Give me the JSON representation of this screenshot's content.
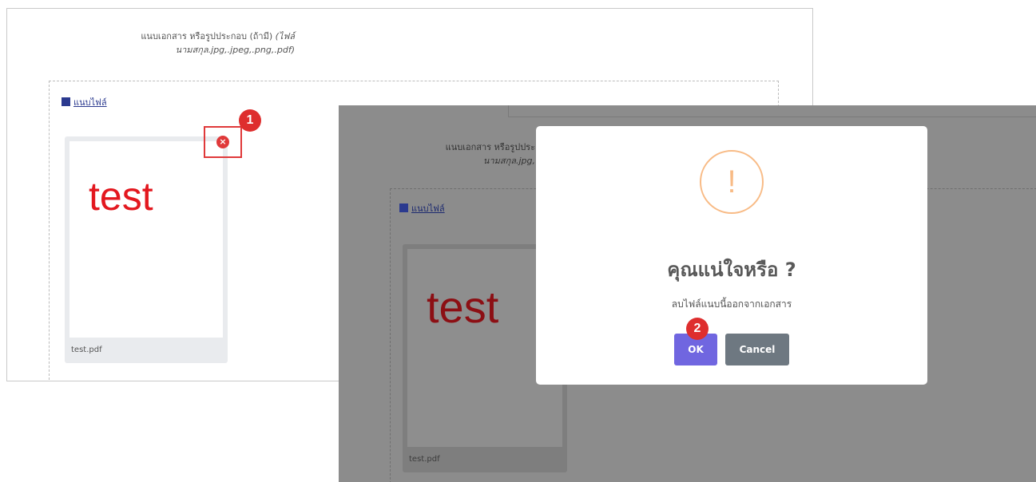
{
  "before": {
    "field_label": "แนบเอกสาร หรือรูปประกอบ (ถ้ามี)",
    "field_hint": "(ไฟล์นามสกุล.jpg,.jpeg,.png,.pdf)",
    "attach_link": "แนบไฟล์",
    "file_preview_text": "test",
    "file_name": "test.pdf",
    "remove_symbol": "×",
    "step_marker": "1"
  },
  "after": {
    "field_label": "แนบเอกสาร หรือรูปประ",
    "field_hint": "นามสกุล.jpg,",
    "attach_link": "แนบไฟล์",
    "file_preview_text": "test",
    "file_name": "test.pdf"
  },
  "dialog": {
    "icon_symbol": "!",
    "title": "คุณแน่ใจหรือ ?",
    "message": "ลบไฟล์แนบนี้ออกจากเอกสาร",
    "ok_label": "OK",
    "cancel_label": "Cancel",
    "step_marker": "2"
  },
  "colors": {
    "accent_red": "#e0393a",
    "ok_button": "#7066e0",
    "cancel_button": "#6e7881",
    "warning_icon": "#f8bb86",
    "overlay": "#8c8c8c"
  },
  "icons": {
    "attach": "file-icon",
    "remove": "close-circle-icon",
    "warning": "exclamation-circle-icon"
  }
}
